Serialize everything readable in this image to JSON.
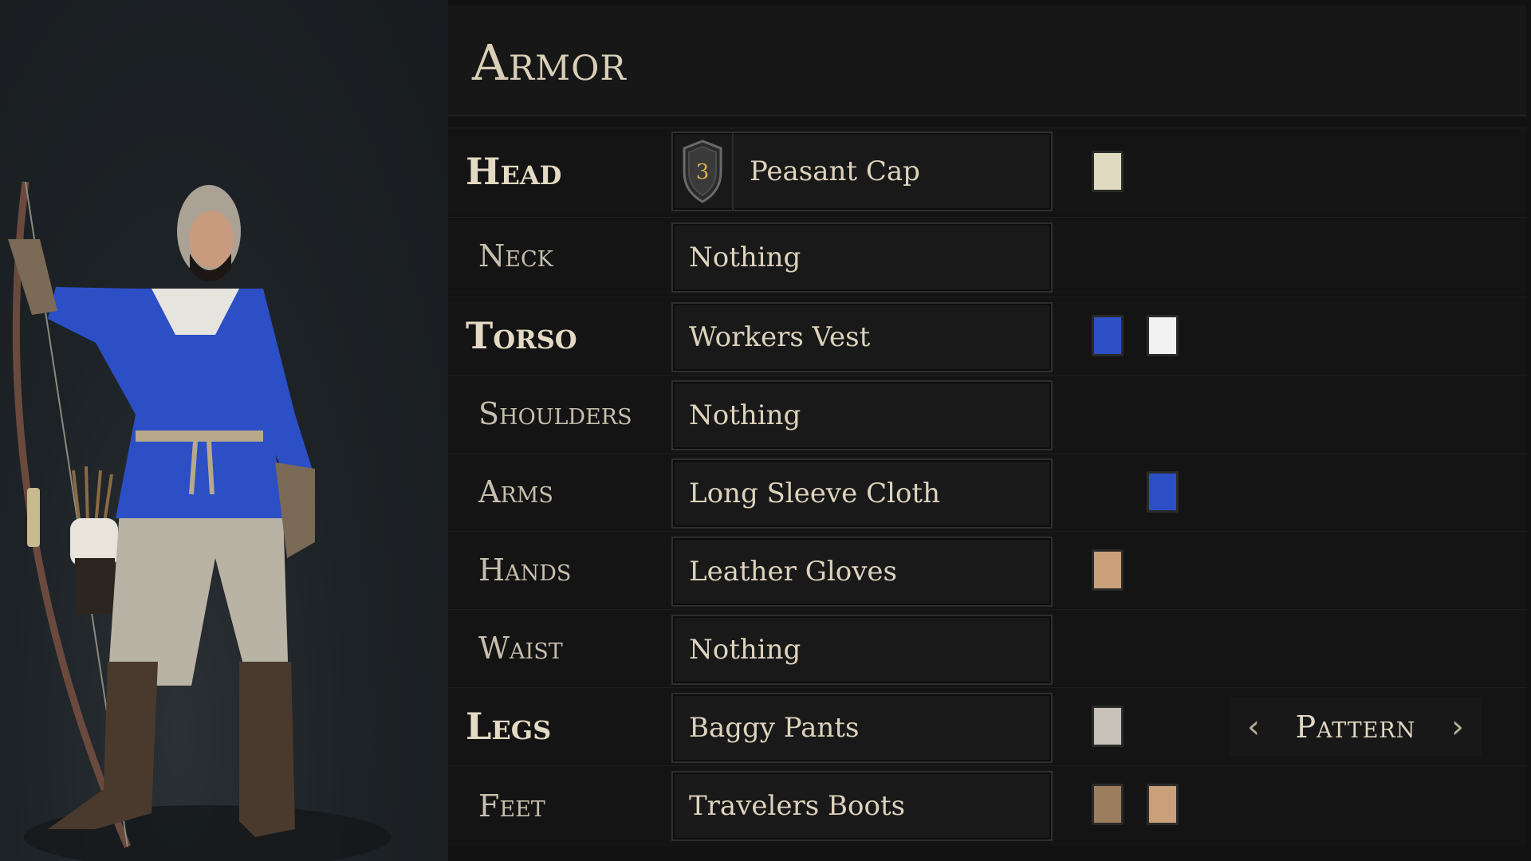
{
  "panel": {
    "title": "Armor"
  },
  "slots": [
    {
      "label": "Head",
      "item": "Peasant Cap",
      "tier": "3",
      "swatches": [
        "#e0dac0"
      ]
    },
    {
      "label": "Neck",
      "item": "Nothing"
    },
    {
      "label": "Torso",
      "item": "Workers Vest",
      "swatches": [
        "#2c4fc6",
        "#f2f2f2"
      ]
    },
    {
      "label": "Shoulders",
      "item": "Nothing"
    },
    {
      "label": "Arms",
      "item": "Long Sleeve Cloth",
      "swatches": [
        "#2c4fc6"
      ]
    },
    {
      "label": "Hands",
      "item": "Leather Gloves",
      "swatches": [
        "#c9a07a"
      ]
    },
    {
      "label": "Waist",
      "item": "Nothing"
    },
    {
      "label": "Legs",
      "item": "Baggy Pants",
      "swatches": [
        "#c7c1b8"
      ]
    },
    {
      "label": "Feet",
      "item": "Travelers Boots",
      "swatches": [
        "#9c7d5e",
        "#c9a07a"
      ]
    }
  ],
  "pattern": {
    "label": "Pattern",
    "prev_icon": "chevron-left-icon",
    "next_icon": "chevron-right-icon"
  },
  "colors": {
    "accent_text": "#d9cfb8",
    "tier_number": "#d8b04a"
  }
}
